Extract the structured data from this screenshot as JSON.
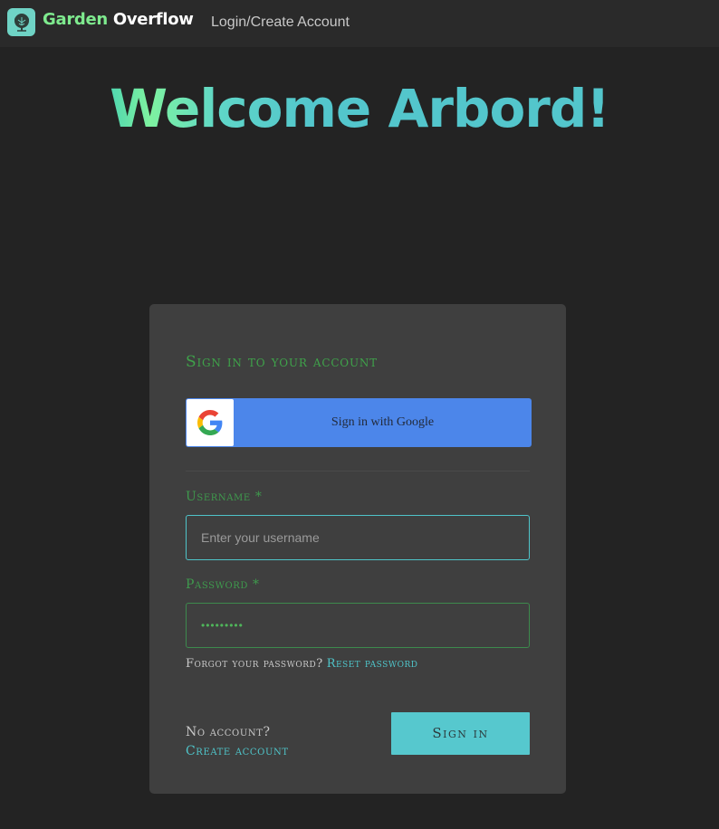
{
  "header": {
    "brand_part1": "Garden",
    "brand_part2": "Overflow",
    "nav_login": "Login/Create Account",
    "logo_icon": "tree-icon"
  },
  "welcome": {
    "text": "Welcome Arbord!"
  },
  "signin_card": {
    "title": "Sign in to your account",
    "google_button_label": "Sign in with Google",
    "google_icon": "google-g-icon",
    "username_label": "Username *",
    "username_placeholder": "Enter your username",
    "username_value": "",
    "password_label": "Password *",
    "password_value": "•••••••••",
    "forgot_text": "Forgot your password?",
    "reset_link": "Reset password",
    "no_account_text": "No account?",
    "create_account_link": "Create account",
    "signin_button": "Sign in"
  },
  "colors": {
    "page_bg": "#232323",
    "topbar_bg": "#2a2a2a",
    "card_bg": "#3f3f3f",
    "accent_teal": "#53c6cc",
    "accent_green": "#3fa24a",
    "brand_green": "#7eea8e",
    "google_blue": "#4c86ea"
  }
}
